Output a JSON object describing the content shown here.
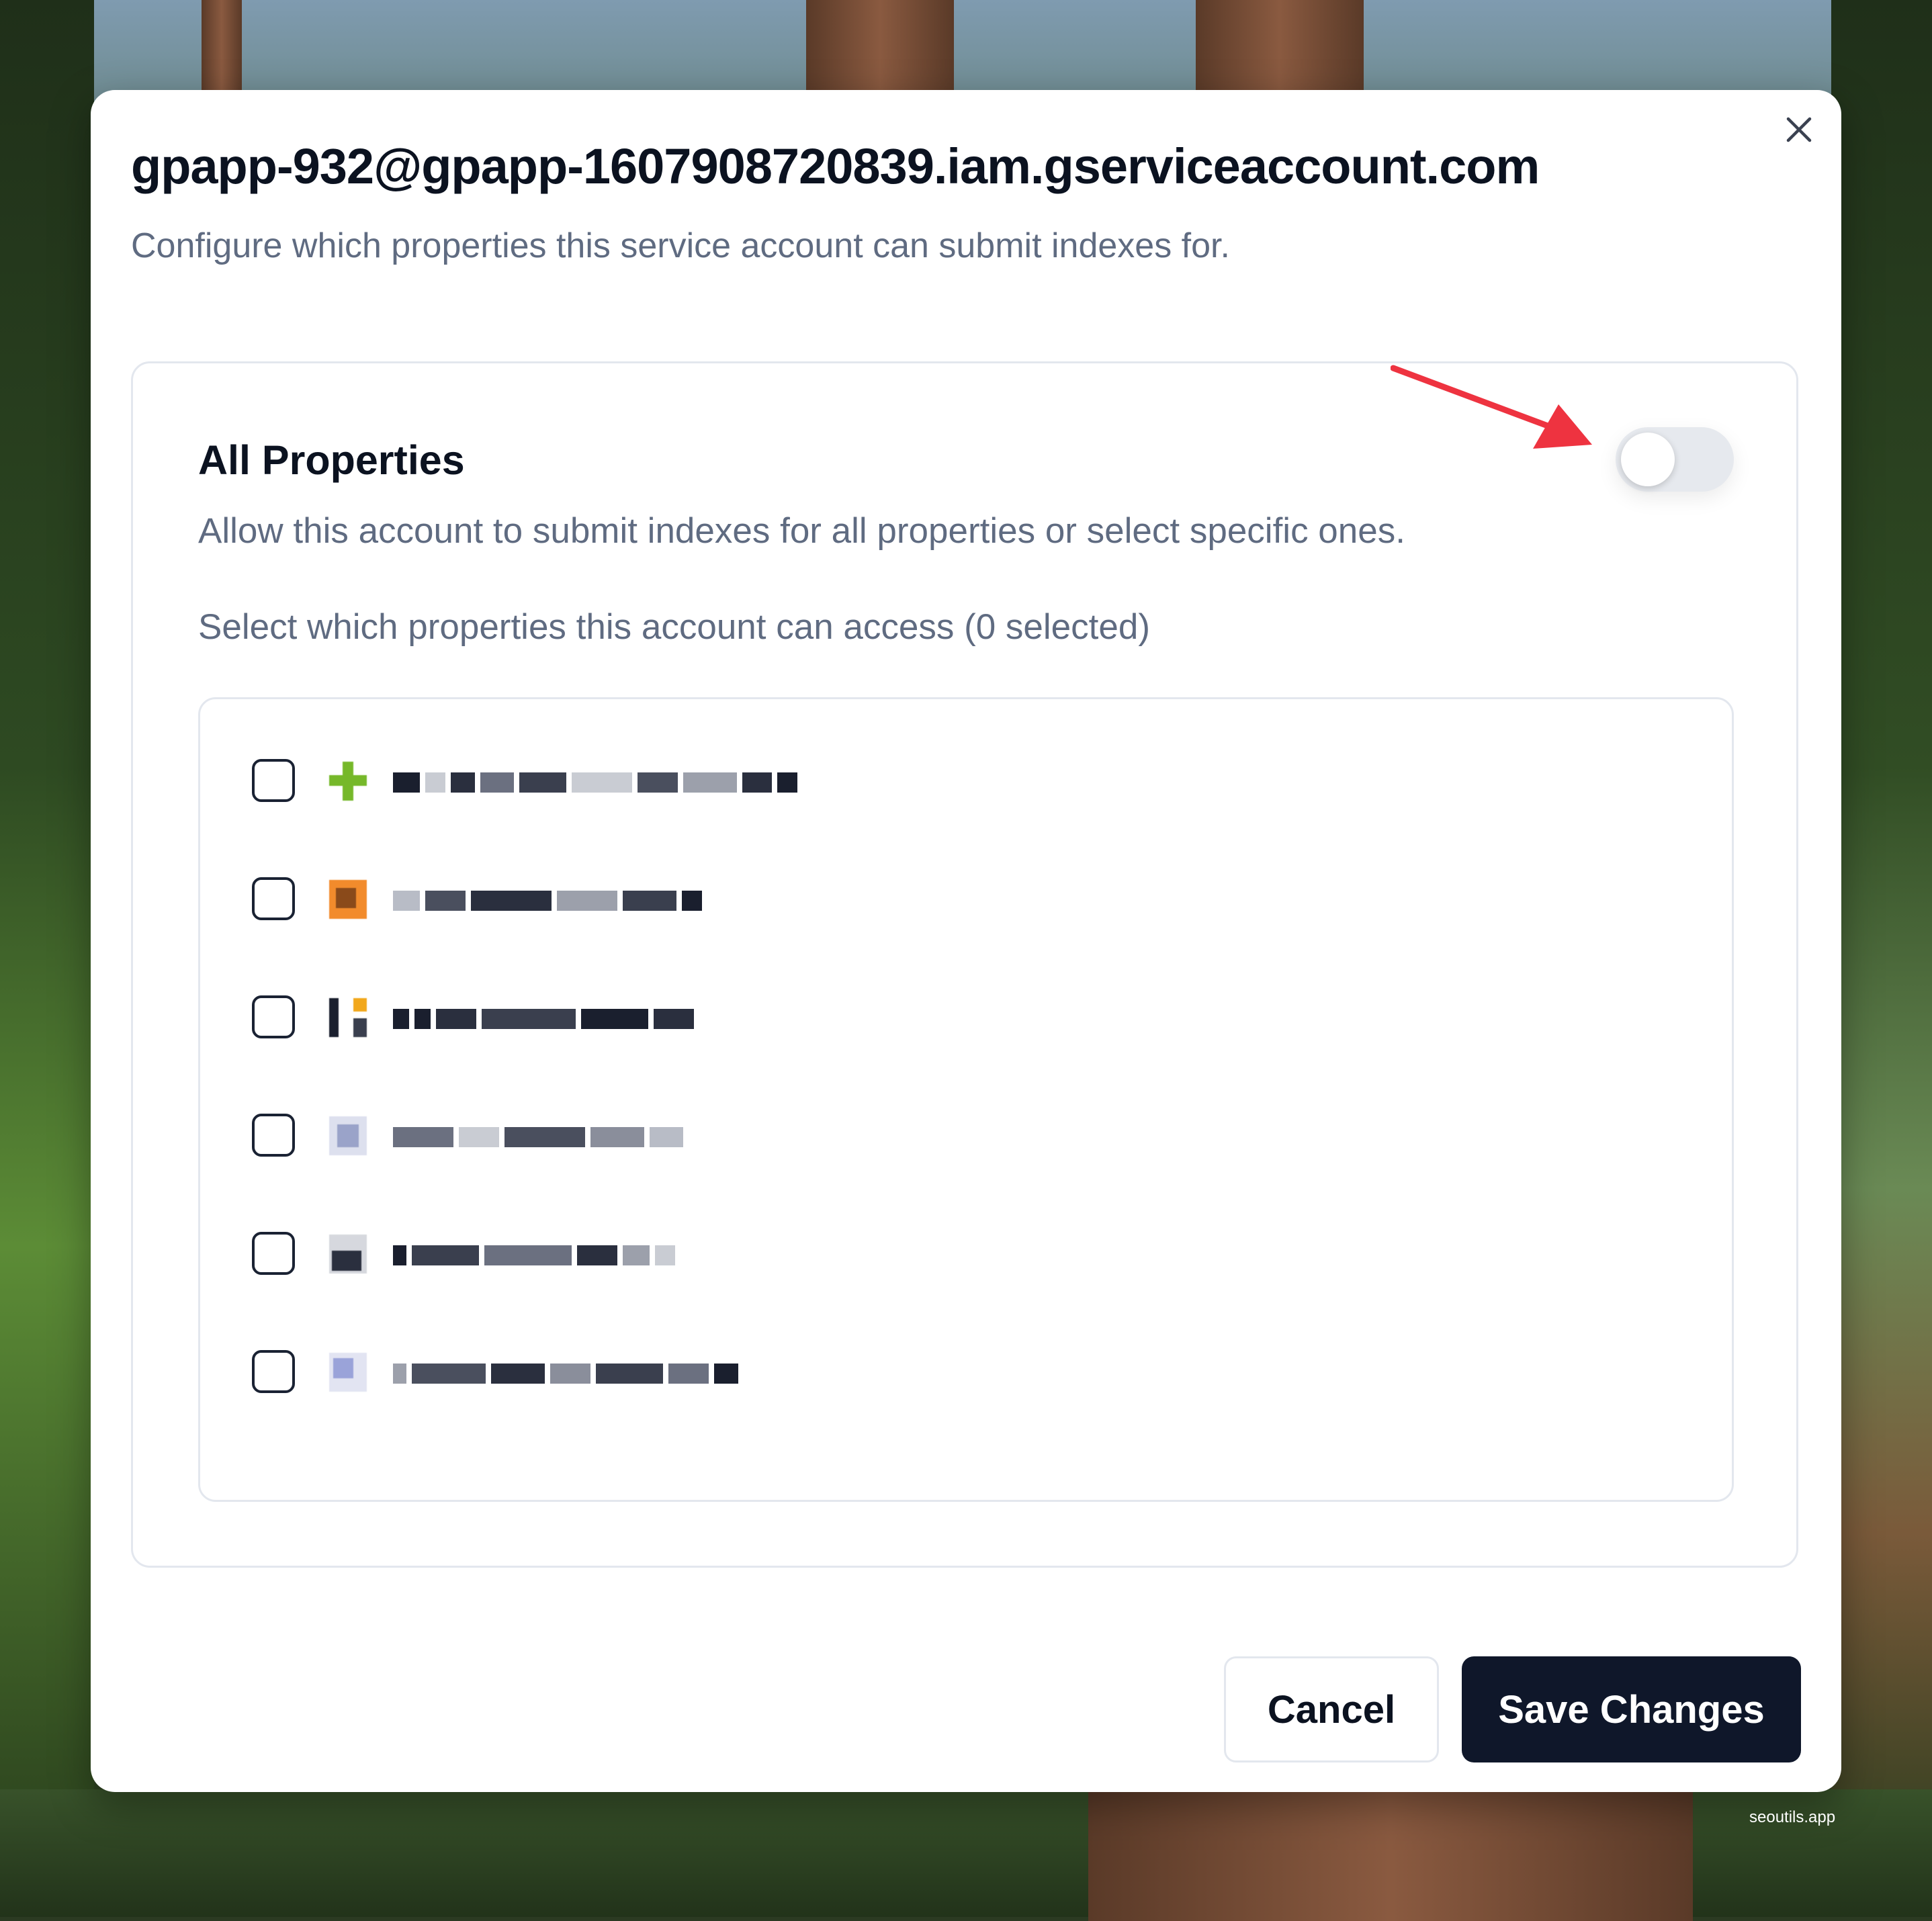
{
  "dialog": {
    "title": "gpapp-932@gpapp-1607908720839.iam.gserviceaccount.com",
    "subtitle": "Configure which properties this service account can submit indexes for."
  },
  "all_properties": {
    "title": "All Properties",
    "description": "Allow this account to submit indexes for all properties or select specific ones.",
    "toggle_on": false
  },
  "selection": {
    "label": "Select which properties this account can access (0 selected)"
  },
  "properties": [
    {
      "name": "",
      "checked": false,
      "favicon_color": "#76b82a"
    },
    {
      "name": "",
      "checked": false,
      "favicon_color": "#f28b2c"
    },
    {
      "name": "",
      "checked": false,
      "favicon_color": "#1a1f2e"
    },
    {
      "name": "",
      "checked": false,
      "favicon_color": "#9aa3c9"
    },
    {
      "name": "",
      "checked": false,
      "favicon_color": "#2a2f3e"
    },
    {
      "name": "",
      "checked": false,
      "favicon_color": "#9aa3d9"
    }
  ],
  "buttons": {
    "cancel": "Cancel",
    "save": "Save Changes"
  },
  "watermark": "seoutils.app",
  "colors": {
    "primary_button": "#0f172a",
    "annotation_arrow": "#ee3340",
    "muted_text": "#5f6b81"
  }
}
